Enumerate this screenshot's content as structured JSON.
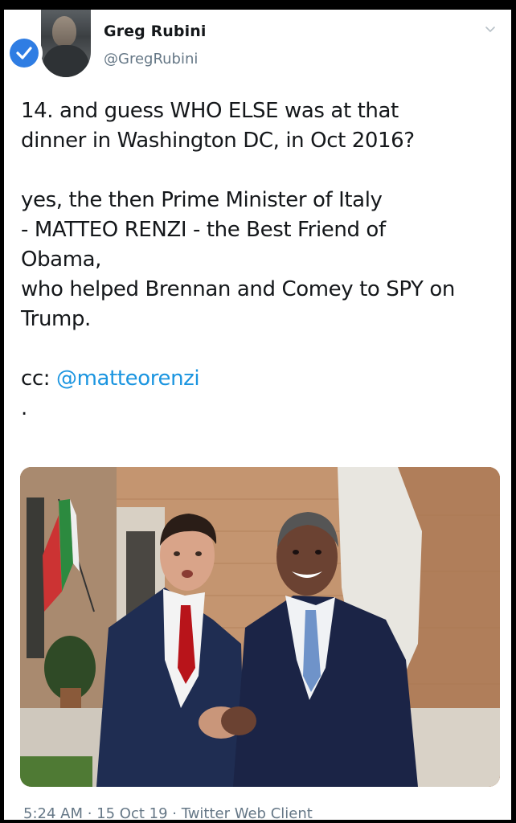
{
  "tweet": {
    "author_name": "Greg Rubini",
    "author_handle": "@GregRubini",
    "verified_icon": "verified-check-icon",
    "menu_icon": "chevron-down-icon",
    "paragraph_1_line_1": "14. and guess WHO ELSE was at that",
    "paragraph_1_line_2": "dinner in Washington DC, in Oct 2016?",
    "paragraph_2_line_1": "yes, the then Prime Minister of Italy",
    "paragraph_2_line_2": "- MATTEO RENZI - the Best Friend of",
    "paragraph_2_line_3": "Obama,",
    "paragraph_2_line_4": "who helped Brennan and Comey to SPY on",
    "paragraph_2_line_5": "Trump.",
    "cc_label": "cc:",
    "cc_mention": "@matteorenzi",
    "trailing_dot": ".",
    "footer": "5:24 AM · 15 Oct 19 · Twitter Web Client"
  },
  "colors": {
    "link": "#1b95e0",
    "verified": "#2f7de3",
    "text": "#14171a",
    "secondary": "#657786"
  }
}
